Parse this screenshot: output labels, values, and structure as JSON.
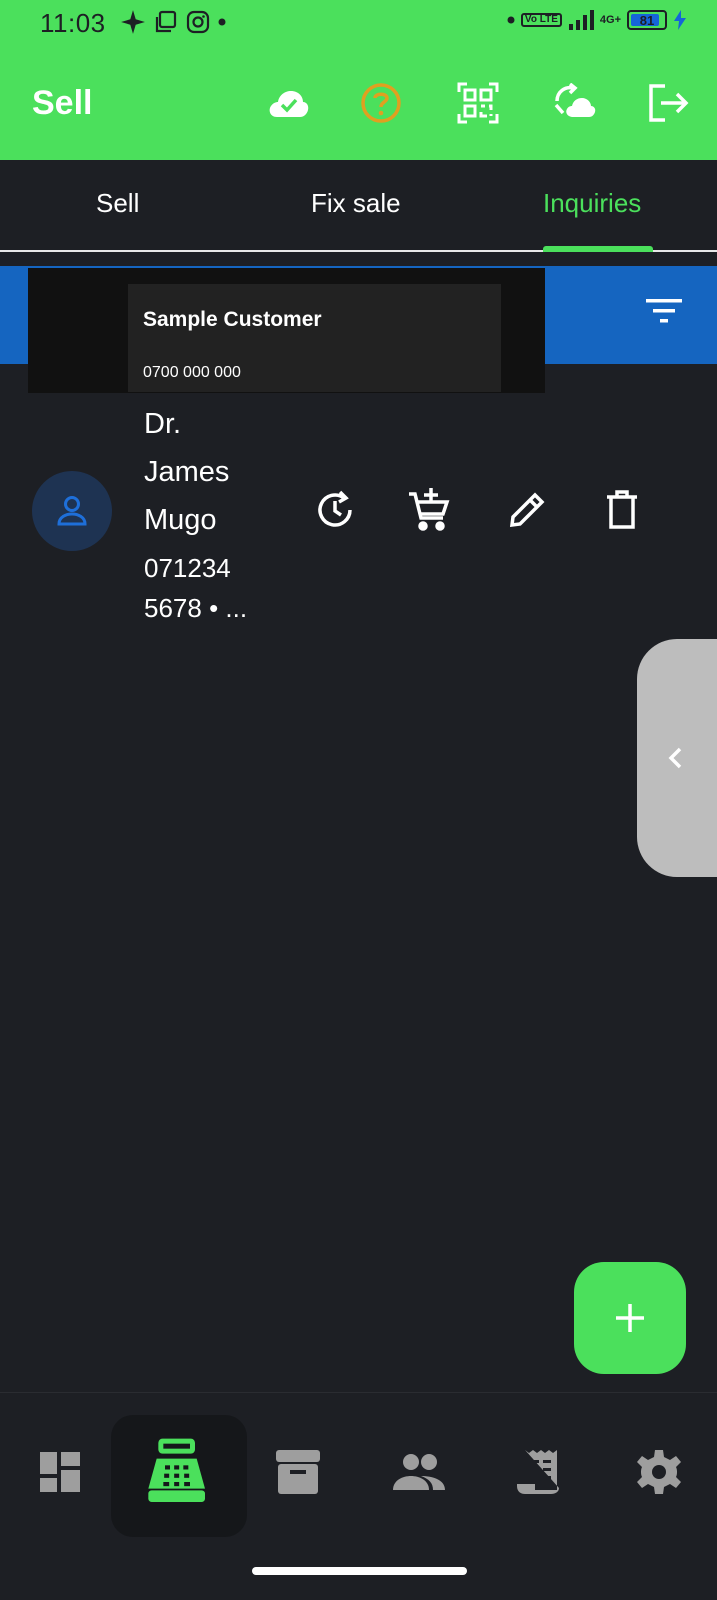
{
  "status_bar": {
    "time": "11:03",
    "network": "4G+",
    "volte": "Vo LTE",
    "battery": "81"
  },
  "app_bar": {
    "title": "Sell",
    "icons": [
      "cloud-check-icon",
      "help-icon",
      "qr-scan-icon",
      "cloud-sync-icon",
      "logout-icon"
    ]
  },
  "tabs": [
    {
      "label": "Sell",
      "active": false
    },
    {
      "label": "Fix sale",
      "active": false
    },
    {
      "label": "Inquiries",
      "active": true
    }
  ],
  "popup": {
    "customer_name": "Sample Customer",
    "customer_phone": "0700 000 000"
  },
  "list": {
    "items": [
      {
        "name": "Dr. James Mugo",
        "phone_line1": "071234",
        "phone_line2": "5678 • ..."
      }
    ]
  },
  "bottom_nav": {
    "items": [
      "dashboard-icon",
      "cash-register-icon",
      "archive-icon",
      "people-icon",
      "receipt-icon",
      "settings-icon"
    ],
    "active_index": 1
  },
  "colors": {
    "accent": "#4be05c",
    "background": "#1d1f24",
    "blue_bar": "#1565c0",
    "help_icon": "#e0a020"
  }
}
